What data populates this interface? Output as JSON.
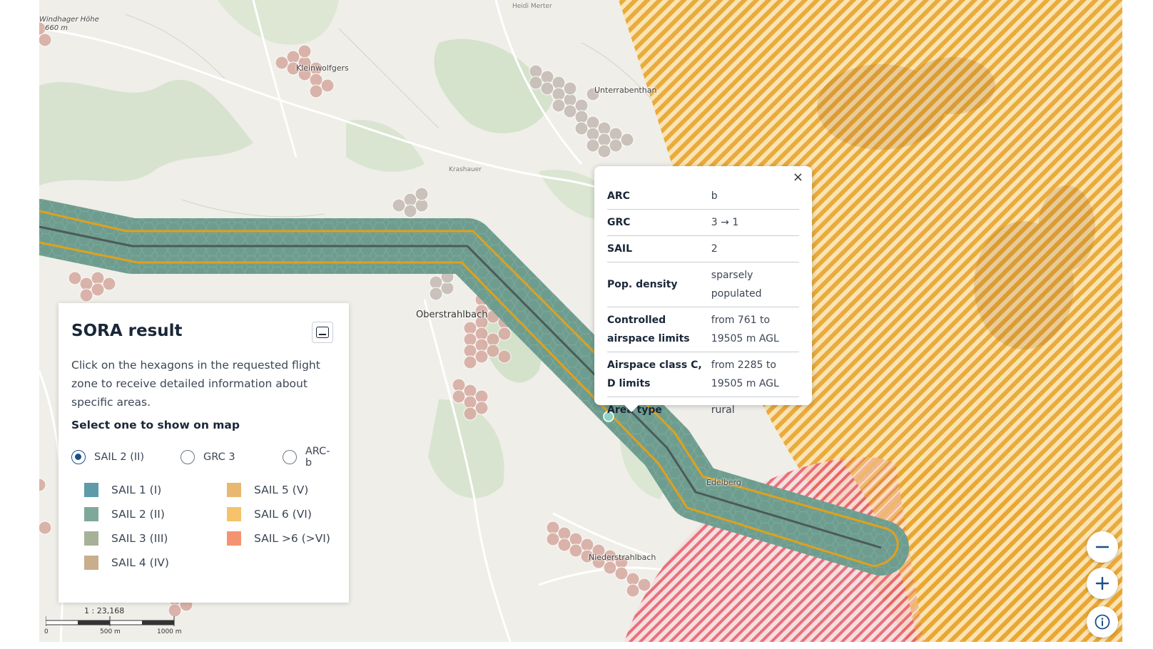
{
  "map": {
    "places": [
      {
        "name": "Windhager Höhe"
      },
      {
        "name": "660 m"
      },
      {
        "name": "Kleinwolfgers"
      },
      {
        "name": "Unterrabenthan"
      },
      {
        "name": "Krashauer"
      },
      {
        "name": "Oberstrahlbach"
      },
      {
        "name": "Niederstrahlbach"
      },
      {
        "name": "Edelberg"
      },
      {
        "name": "Heidi Merter"
      }
    ],
    "scale_text": "1 : 23,168",
    "scale_labels": [
      "0",
      "500 m",
      "1000 m"
    ],
    "colors": {
      "hex_sail2": "#6e9c8e",
      "hex_sail4": "#c9a59b",
      "hex_gray": "#c9c9c9",
      "route_outline": "#e0a11c",
      "zone_orange": "#e8a733",
      "zone_red": "#e0495a"
    }
  },
  "panel": {
    "title": "SORA result",
    "description": "Click on the hexagons in the requested flight zone to receive detailed information about specific areas.",
    "select_label": "Select one to show on map",
    "radio_options": [
      {
        "label": "SAIL 2 (II)",
        "checked": true
      },
      {
        "label": "GRC 3",
        "checked": false
      },
      {
        "label": "ARC-b",
        "checked": false
      }
    ],
    "legend": [
      {
        "label": "SAIL 1 (I)",
        "color": "#5f9aa9"
      },
      {
        "label": "SAIL 5 (V)",
        "color": "#e8b870"
      },
      {
        "label": "SAIL 2 (II)",
        "color": "#7fa89a"
      },
      {
        "label": "SAIL 6 (VI)",
        "color": "#f4c36b"
      },
      {
        "label": "SAIL 3 (III)",
        "color": "#a6b297"
      },
      {
        "label": "SAIL >6 (>VI)",
        "color": "#f49371"
      },
      {
        "label": "SAIL 4 (IV)",
        "color": "#c9ae8c"
      }
    ]
  },
  "popup": {
    "close_symbol": "×",
    "rows": [
      {
        "key": "ARC",
        "value": "b"
      },
      {
        "key": "GRC",
        "value": "3 → 1"
      },
      {
        "key": "SAIL",
        "value": "2"
      },
      {
        "key": "Pop. density",
        "value": "sparsely populated"
      },
      {
        "key": "Controlled airspace limits",
        "value": "from 761 to 19505 m AGL"
      },
      {
        "key": "Airspace class C, D limits",
        "value": "from 2285 to 19505 m AGL"
      },
      {
        "key": "Area type",
        "value": "rural"
      }
    ]
  },
  "controls": {
    "zoom_out_icon": "minus-icon",
    "zoom_in_icon": "plus-icon",
    "info_icon": "info-icon"
  }
}
